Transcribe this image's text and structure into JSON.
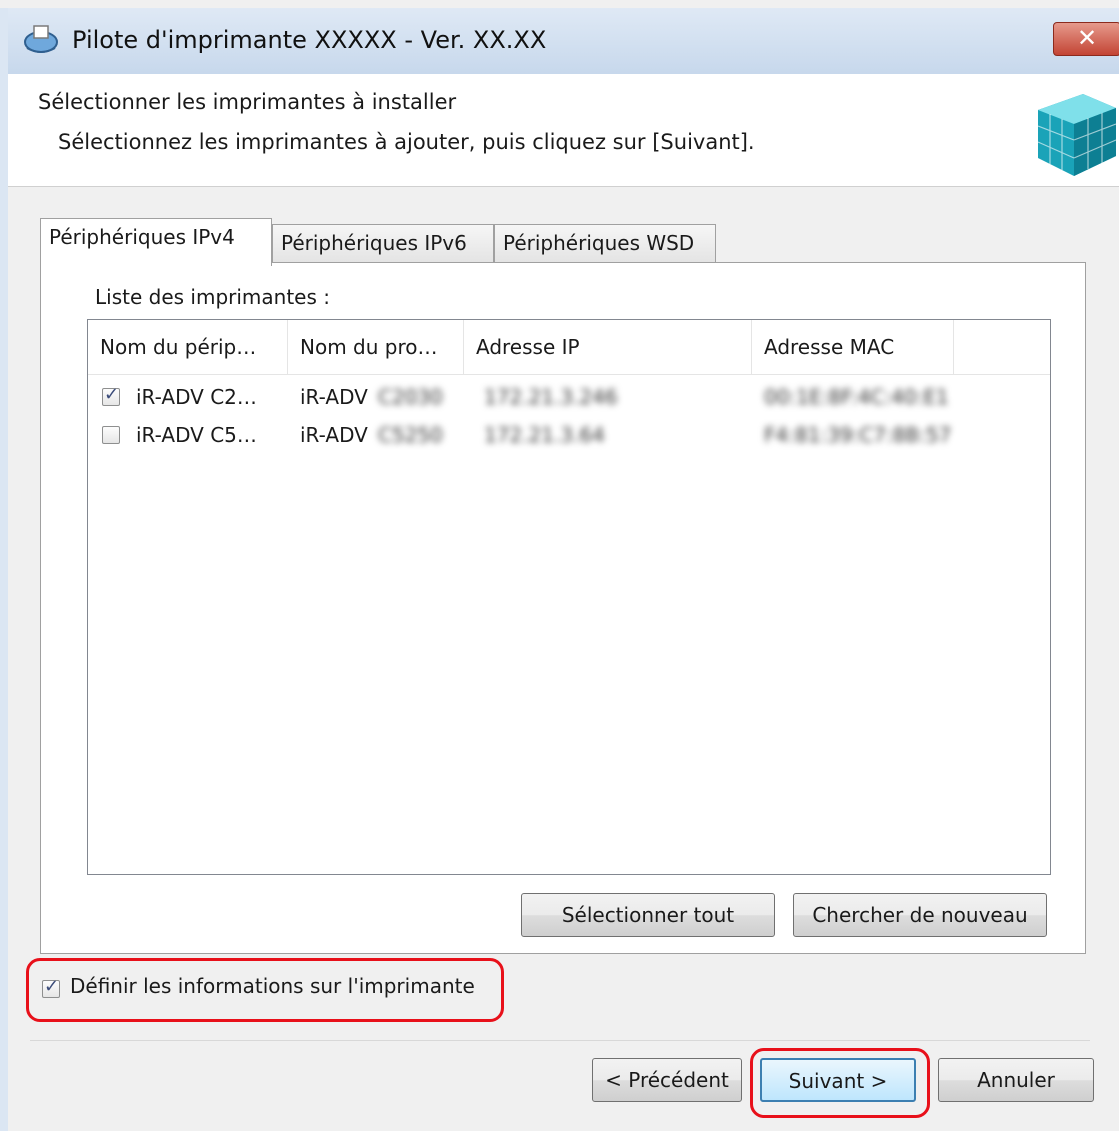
{
  "window": {
    "title": "Pilote d'imprimante XXXXX - Ver. XX.XX",
    "close_label": "✕"
  },
  "header": {
    "title": "Sélectionner les imprimantes à installer",
    "subtitle": "Sélectionnez les imprimantes à ajouter, puis cliquez sur [Suivant]."
  },
  "tabs": [
    {
      "label": "Périphériques IPv4",
      "active": true
    },
    {
      "label": "Périphériques IPv6",
      "active": false
    },
    {
      "label": "Périphériques WSD",
      "active": false
    }
  ],
  "printer_list": {
    "label": "Liste des imprimantes :",
    "columns": [
      "Nom du périp…",
      "Nom du pro…",
      "Adresse IP",
      "Adresse MAC"
    ],
    "rows": [
      {
        "checked": true,
        "device_name": "iR-ADV C2…",
        "product_name": "iR-ADV",
        "product_suffix": "C2030",
        "ip": "172.21.3.246",
        "mac": "00:1E:8F:4C:40:E1"
      },
      {
        "checked": false,
        "device_name": "iR-ADV C5…",
        "product_name": "iR-ADV",
        "product_suffix": "C5250",
        "ip": "172.21.3.64",
        "mac": "F4:81:39:C7:8B:57"
      }
    ]
  },
  "buttons": {
    "select_all": "Sélectionner tout",
    "search_again": "Chercher de nouveau",
    "previous": "< Précédent",
    "next": "Suivant >",
    "cancel": "Annuler"
  },
  "set_printer_info": {
    "label": "Définir les informations sur l'imprimante",
    "checked": true
  },
  "colors": {
    "highlight": "#e8101a",
    "titlebar": "#c7d8ec",
    "close_button": "#c34434"
  }
}
